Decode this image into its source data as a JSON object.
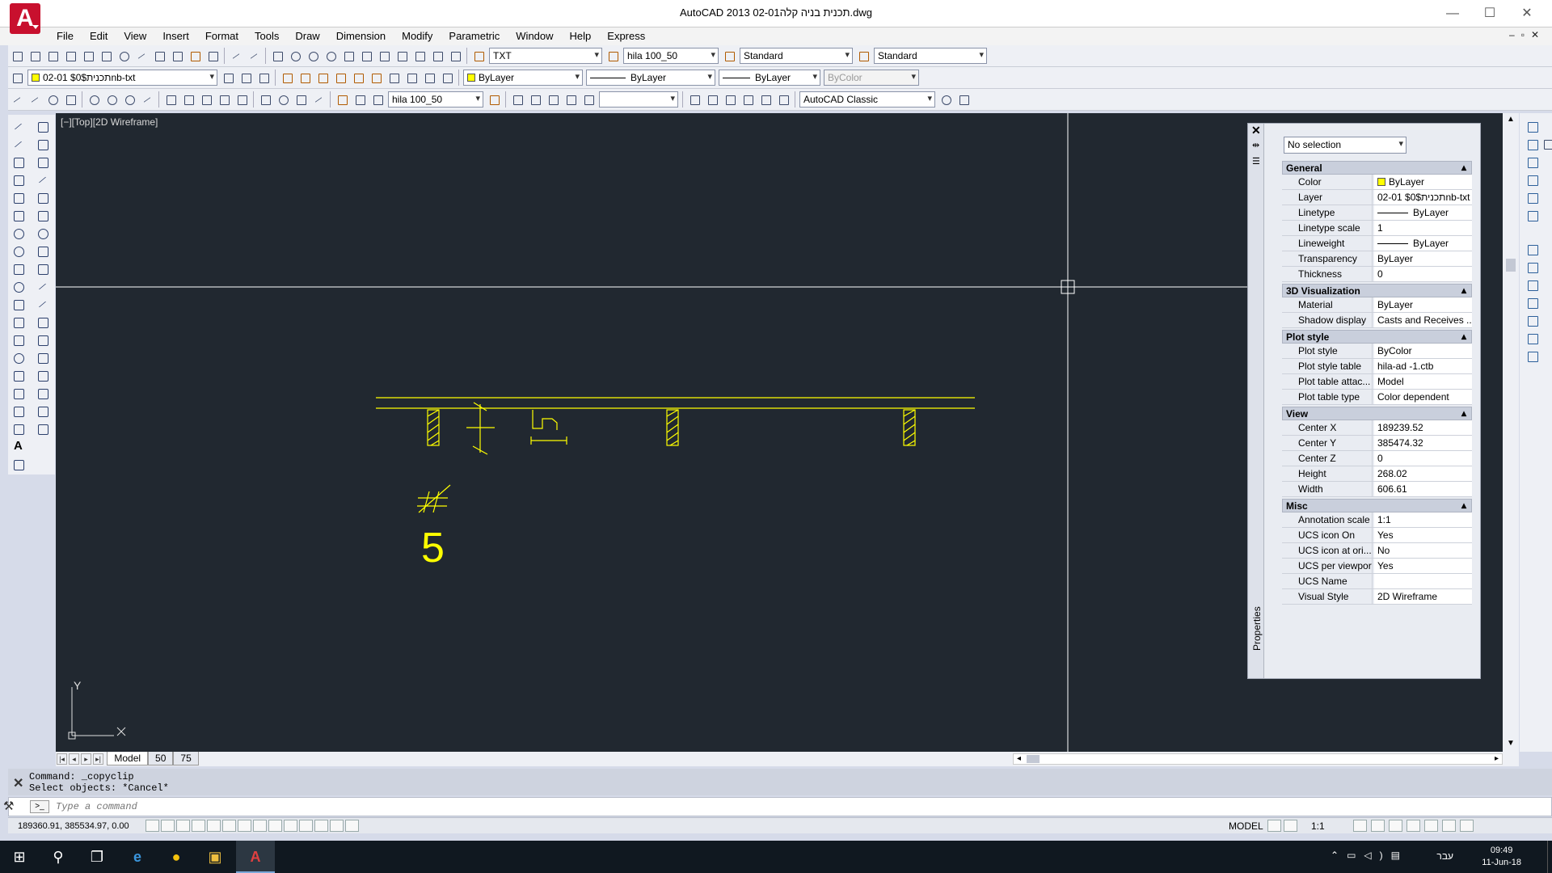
{
  "app": {
    "title": "AutoCAD 2013    02-01תכנית בניה קלה.dwg",
    "logo_letter": "A"
  },
  "menu": [
    "File",
    "Edit",
    "View",
    "Insert",
    "Format",
    "Tools",
    "Draw",
    "Dimension",
    "Modify",
    "Parametric",
    "Window",
    "Help",
    "Express"
  ],
  "toolbars": {
    "text_style": "TXT",
    "dim_style": "hila 100_50",
    "table_style": "Standard",
    "mleader_style": "Standard",
    "layer": "02-01 $0$תכניתnb-txt",
    "color": "ByLayer",
    "linetype": "ByLayer",
    "lineweight": "ByLayer",
    "plotstyle": "ByColor",
    "dim_style2": "hila 100_50",
    "workspace": "AutoCAD Classic",
    "blank_dd": ""
  },
  "viewport": {
    "label": "[−][Top][2D Wireframe]",
    "digit": "5",
    "ucs_x": "X",
    "ucs_y": "Y"
  },
  "layout_tabs": [
    "Model",
    "50",
    "75"
  ],
  "command": {
    "history1": "Command: _copyclip",
    "history2": "Select objects: *Cancel*",
    "placeholder": "Type a command",
    "close": "✕",
    "wrench": "🔧"
  },
  "status": {
    "coords": "189360.91, 385534.97, 0.00",
    "model": "MODEL",
    "ann_scale": "1:1"
  },
  "properties": {
    "palette_title": "Properties",
    "selection": "No selection",
    "sections": [
      {
        "title": "General",
        "rows": [
          {
            "k": "Color",
            "v": "ByLayer",
            "swatch": true
          },
          {
            "k": "Layer",
            "v": "02-01 $0$תכניתnb-txt"
          },
          {
            "k": "Linetype",
            "v": "ByLayer",
            "line": true
          },
          {
            "k": "Linetype scale",
            "v": "1"
          },
          {
            "k": "Lineweight",
            "v": "ByLayer",
            "line": true
          },
          {
            "k": "Transparency",
            "v": "ByLayer"
          },
          {
            "k": "Thickness",
            "v": "0"
          }
        ]
      },
      {
        "title": "3D Visualization",
        "rows": [
          {
            "k": "Material",
            "v": "ByLayer"
          },
          {
            "k": "Shadow display",
            "v": "Casts and Receives ..."
          }
        ]
      },
      {
        "title": "Plot style",
        "rows": [
          {
            "k": "Plot style",
            "v": "ByColor"
          },
          {
            "k": "Plot style table",
            "v": "hila-ad -1.ctb"
          },
          {
            "k": "Plot table attac...",
            "v": "Model"
          },
          {
            "k": "Plot table type",
            "v": "Color dependent"
          }
        ]
      },
      {
        "title": "View",
        "rows": [
          {
            "k": "Center X",
            "v": "189239.52"
          },
          {
            "k": "Center Y",
            "v": "385474.32"
          },
          {
            "k": "Center Z",
            "v": "0"
          },
          {
            "k": "Height",
            "v": "268.02"
          },
          {
            "k": "Width",
            "v": "606.61"
          }
        ]
      },
      {
        "title": "Misc",
        "rows": [
          {
            "k": "Annotation scale",
            "v": "1:1"
          },
          {
            "k": "UCS icon On",
            "v": "Yes"
          },
          {
            "k": "UCS icon at ori...",
            "v": "No"
          },
          {
            "k": "UCS per viewport",
            "v": "Yes"
          },
          {
            "k": "UCS Name",
            "v": ""
          },
          {
            "k": "Visual Style",
            "v": "2D Wireframe"
          }
        ]
      }
    ]
  },
  "taskbar": {
    "time": "09:49",
    "date": "11-Jun-18",
    "lang": "עבר"
  },
  "colors": {
    "drawing_bg": "#212830",
    "entity": "#ffff00",
    "crosshair": "#ffffff"
  }
}
